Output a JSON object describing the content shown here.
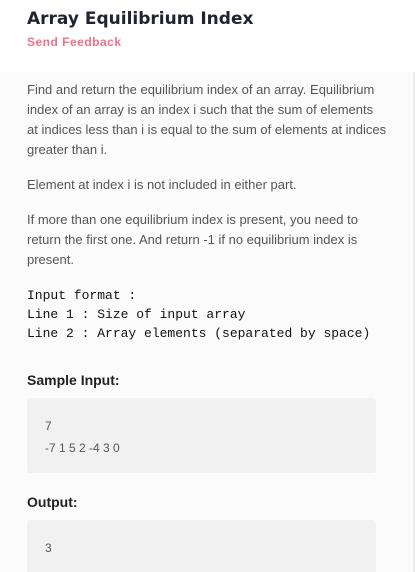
{
  "header": {
    "title": "Array Equilibrium Index",
    "feedback_link": "Send Feedback"
  },
  "problem": {
    "paragraphs": [
      "Find and return the equilibrium index of an array. Equilibrium index of an array is an index i such that the sum of elements at indices less than i is equal to the sum of elements at indices greater than i.",
      "Element at index i is not included in either part.",
      "If more than one equilibrium index is present, you need to return the first one. And return -1 if no equilibrium index is present."
    ],
    "input_format": [
      "Input format :",
      "Line 1 : Size of input array",
      "Line 2 : Array elements (separated by space)"
    ]
  },
  "sample": {
    "input_label": "Sample Input:",
    "input_lines": [
      "7",
      "-7 1 5 2 -4 3 0"
    ],
    "output_label": "Output:",
    "output_lines": [
      "3"
    ]
  },
  "colors": {
    "accent": "#f0708a",
    "title": "#1f2430",
    "panel_bg": "#fbfbfb",
    "sample_bg": "#f1f1f1"
  }
}
